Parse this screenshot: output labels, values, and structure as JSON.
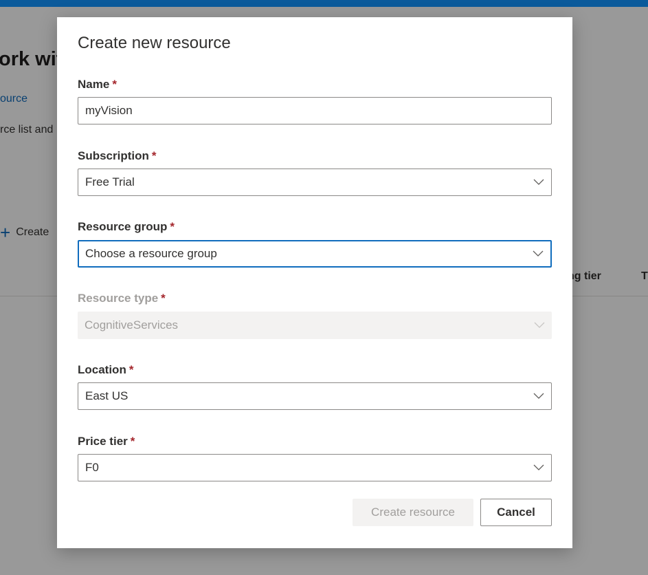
{
  "background": {
    "title_fragment": "ork wit",
    "link_fragment": "ource",
    "description_fragment": "rce list and",
    "create_fragment": "Create",
    "table_headers": [
      "ng tier",
      "T"
    ]
  },
  "dialog": {
    "title": "Create new resource",
    "required_marker": "*",
    "fields": {
      "name": {
        "label": "Name",
        "value": "myVision"
      },
      "subscription": {
        "label": "Subscription",
        "value": "Free Trial"
      },
      "resource_group": {
        "label": "Resource group",
        "placeholder": "Choose a resource group"
      },
      "resource_type": {
        "label": "Resource type",
        "value": "CognitiveServices"
      },
      "location": {
        "label": "Location",
        "value": "East US"
      },
      "price_tier": {
        "label": "Price tier",
        "value": "F0"
      }
    },
    "buttons": {
      "create": "Create resource",
      "cancel": "Cancel"
    }
  },
  "colors": {
    "top_bar": "#0b5a9b",
    "accent": "#0f6cbd",
    "required": "#a4262c",
    "disabled_fill": "#f3f2f1"
  },
  "icons": {
    "dropdown": "chevron-down-icon",
    "add": "plus-icon"
  }
}
